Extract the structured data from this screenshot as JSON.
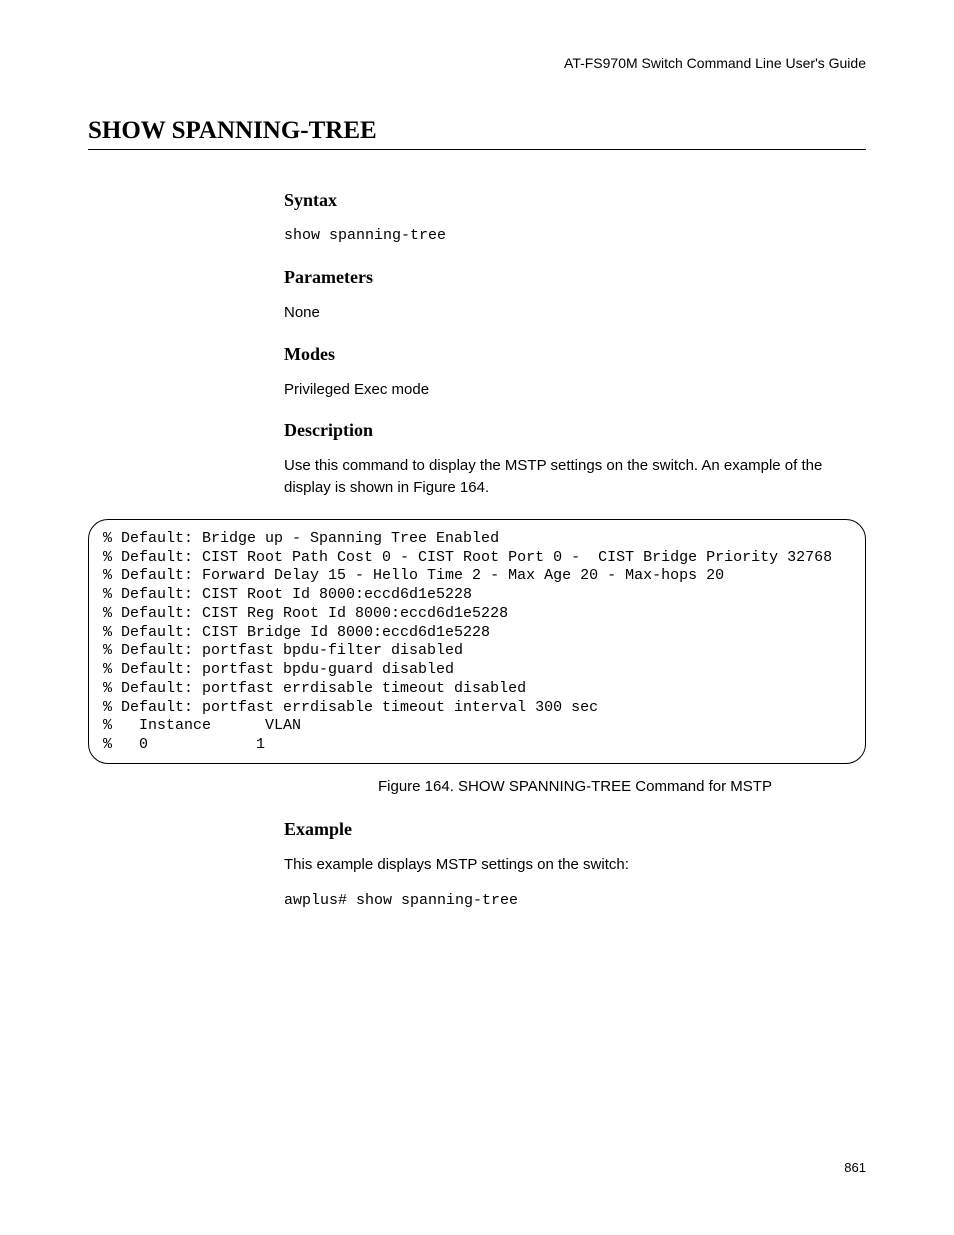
{
  "header": "AT-FS970M Switch Command Line User's Guide",
  "title": "SHOW SPANNING-TREE",
  "sections": {
    "syntax": {
      "heading": "Syntax",
      "body": "show spanning-tree"
    },
    "parameters": {
      "heading": "Parameters",
      "body": "None"
    },
    "modes": {
      "heading": "Modes",
      "body": "Privileged Exec mode"
    },
    "description": {
      "heading": "Description",
      "body": "Use this command to display the MSTP settings on the switch. An example of the display is shown in Figure 164."
    },
    "example": {
      "heading": "Example",
      "body": "This example displays MSTP settings on the switch:",
      "cmd": "awplus# show spanning-tree"
    }
  },
  "code_output": "% Default: Bridge up - Spanning Tree Enabled\n% Default: CIST Root Path Cost 0 - CIST Root Port 0 -  CIST Bridge Priority 32768\n% Default: Forward Delay 15 - Hello Time 2 - Max Age 20 - Max-hops 20\n% Default: CIST Root Id 8000:eccd6d1e5228\n% Default: CIST Reg Root Id 8000:eccd6d1e5228\n% Default: CIST Bridge Id 8000:eccd6d1e5228\n% Default: portfast bpdu-filter disabled\n% Default: portfast bpdu-guard disabled\n% Default: portfast errdisable timeout disabled\n% Default: portfast errdisable timeout interval 300 sec\n%   Instance      VLAN\n%   0            1",
  "figure_caption": "Figure 164. SHOW SPANNING-TREE Command for MSTP",
  "page_number": "861"
}
